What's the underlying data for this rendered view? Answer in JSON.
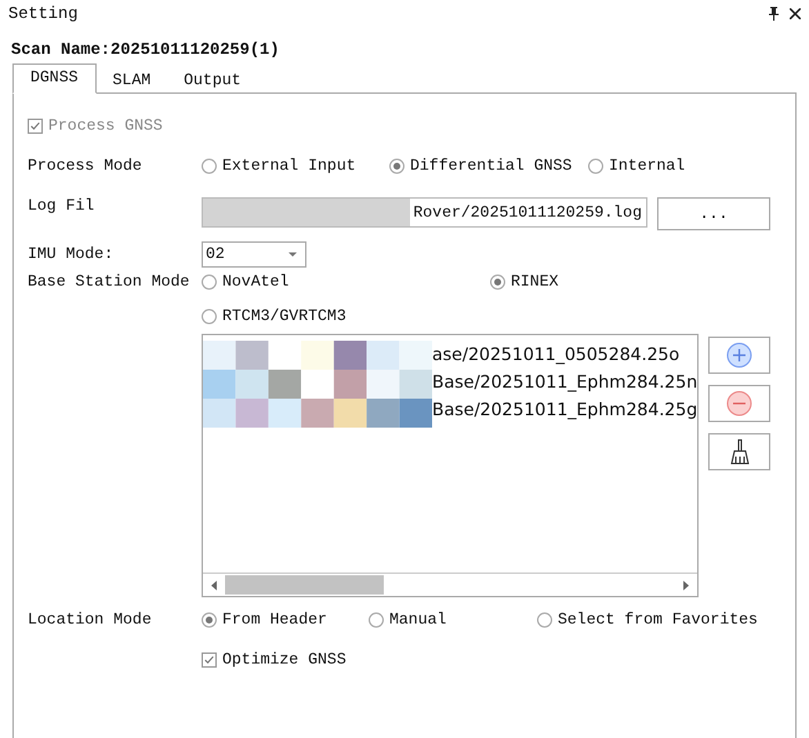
{
  "window": {
    "title": "Setting"
  },
  "scan_name": "Scan Name:20251011120259(1)",
  "tabs": [
    {
      "label": "DGNSS",
      "selected": true
    },
    {
      "label": "SLAM",
      "selected": false
    },
    {
      "label": "Output",
      "selected": false
    }
  ],
  "process_gnss": {
    "label": "Process GNSS",
    "checked": true,
    "disabled": true
  },
  "process_mode": {
    "label": "Process Mode",
    "options": [
      {
        "label": "External Input",
        "selected": false
      },
      {
        "label": "Differential GNSS",
        "selected": true
      },
      {
        "label": "Internal",
        "selected": false
      }
    ]
  },
  "log_file": {
    "label": "Log Fil",
    "value": "Rover/20251011120259.log",
    "browse_button": "..."
  },
  "imu_mode": {
    "label": "IMU Mode:",
    "value": "02"
  },
  "base_station_mode": {
    "label": "Base Station Mode",
    "options": [
      {
        "label": "NovAtel",
        "selected": false
      },
      {
        "label": "RINEX",
        "selected": true
      },
      {
        "label": "RTCM3/GVRTCM3",
        "selected": false
      }
    ]
  },
  "base_files": [
    "ase/20251011_0505284.25o",
    "Base/20251011_Ephm284.25n",
    "Base/20251011_Ephm284.25g"
  ],
  "location_mode": {
    "label": "Location Mode",
    "options": [
      {
        "label": "From Header",
        "selected": true
      },
      {
        "label": "Manual",
        "selected": false
      },
      {
        "label": "Select from Favorites",
        "selected": false
      }
    ]
  },
  "optimize_gnss": {
    "label": "Optimize GNSS",
    "checked": true
  }
}
